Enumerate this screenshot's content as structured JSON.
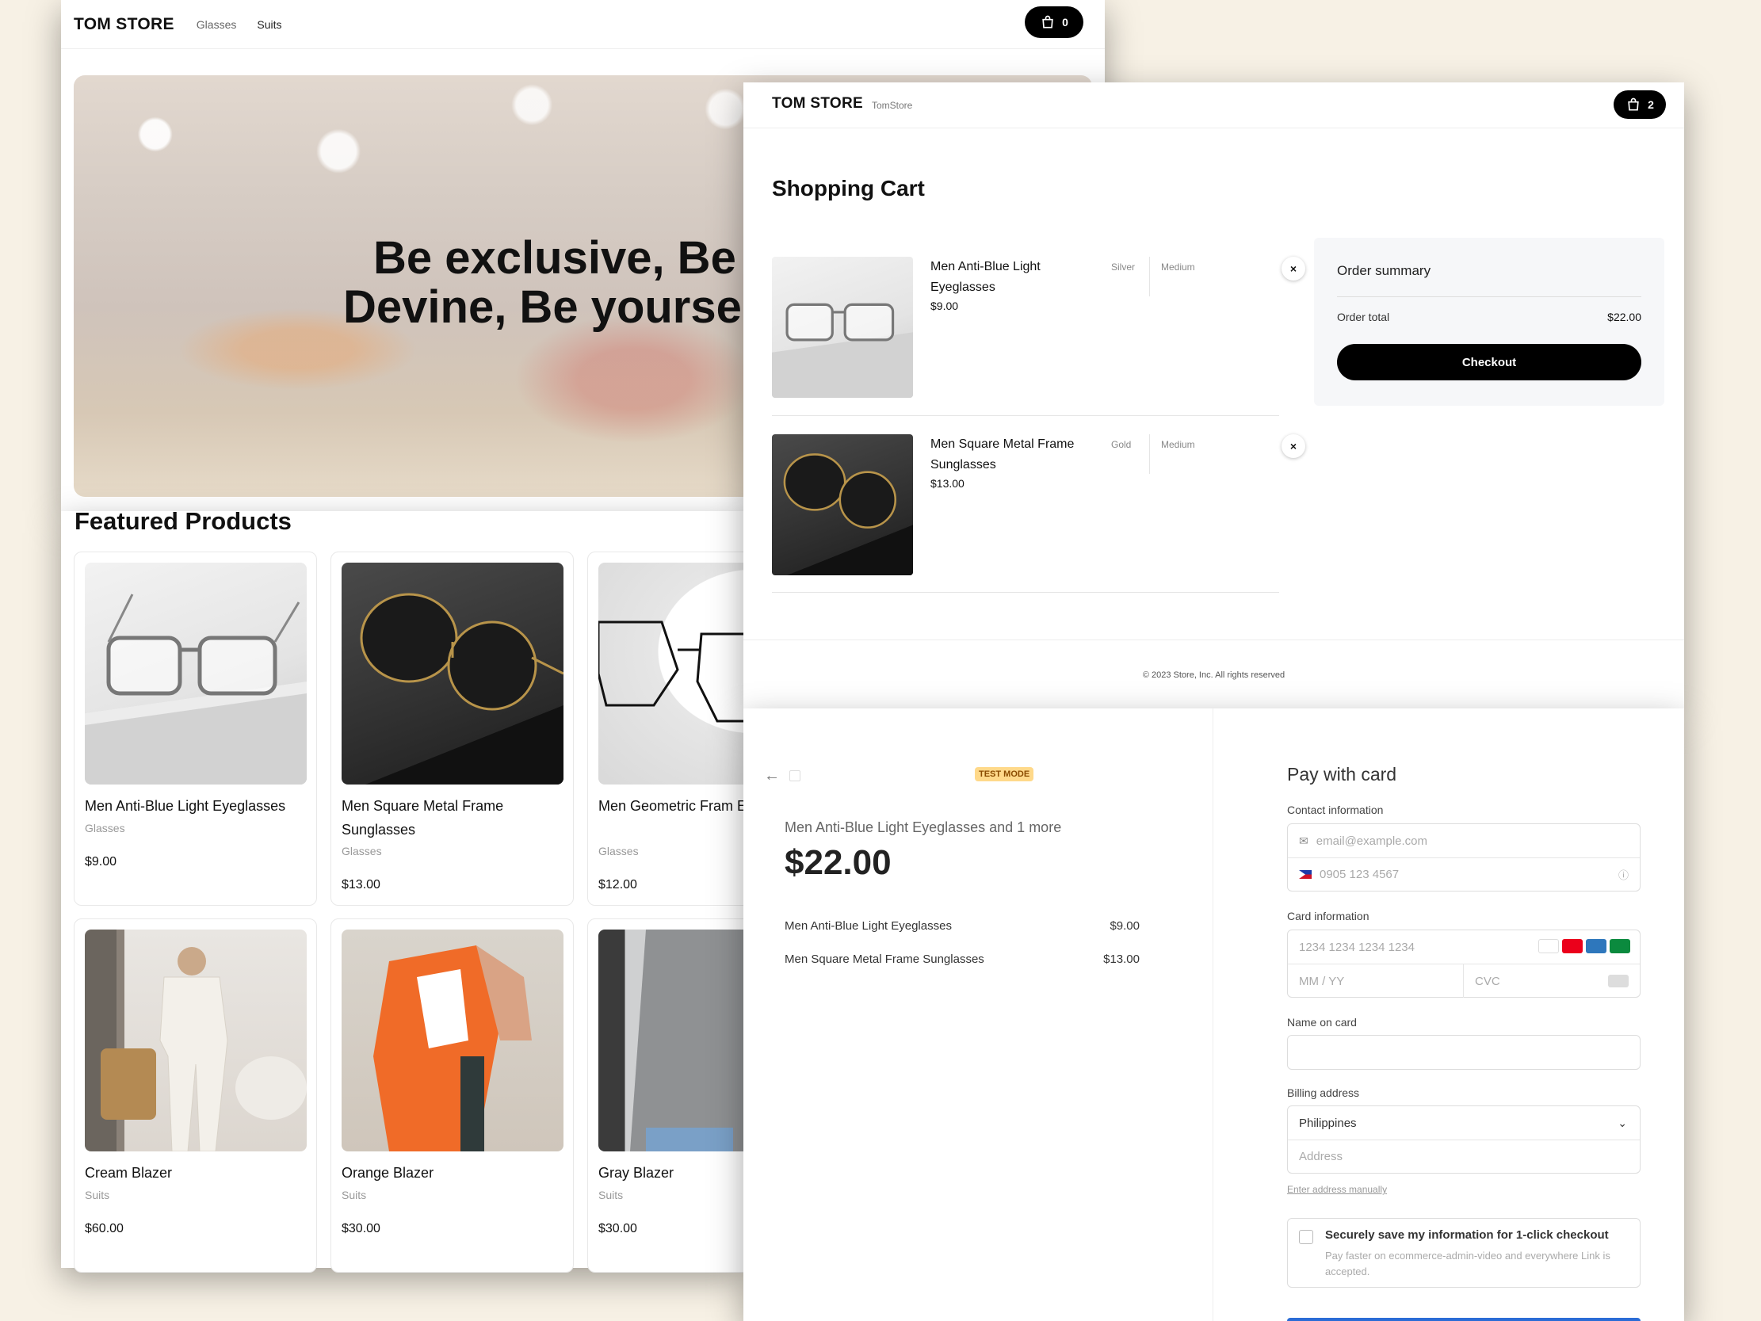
{
  "store": {
    "brand": "TOM STORE",
    "nav": [
      "Glasses",
      "Suits"
    ],
    "cart_count": "0",
    "hero_line1": "Be exclusive, Be",
    "hero_line2": "Devine, Be yourse",
    "featured_title": "Featured Products",
    "products": [
      {
        "name": "Men Anti-Blue Light Eyeglasses",
        "category": "Glasses",
        "price": "$9.00"
      },
      {
        "name": "Men Square Metal Frame Sunglasses",
        "category": "Glasses",
        "price": "$13.00"
      },
      {
        "name": "Men Geometric Fram Eyeglasses",
        "category": "Glasses",
        "price": "$12.00"
      },
      {
        "name": "Cream Blazer",
        "category": "Suits",
        "price": "$60.00"
      },
      {
        "name": "Orange Blazer",
        "category": "Suits",
        "price": "$30.00"
      },
      {
        "name": "Gray Blazer",
        "category": "Suits",
        "price": "$30.00"
      }
    ]
  },
  "cart": {
    "brand": "TOM STORE",
    "subtitle": "TomStore",
    "cart_count": "2",
    "title": "Shopping Cart",
    "items": [
      {
        "name": "Men Anti-Blue Light Eyeglasses",
        "price": "$9.00",
        "color": "Silver",
        "size": "Medium"
      },
      {
        "name": "Men Square Metal Frame Sunglasses",
        "price": "$13.00",
        "color": "Gold",
        "size": "Medium"
      }
    ],
    "remove_glyph": "×",
    "summary": {
      "title": "Order summary",
      "total_label": "Order total",
      "total_value": "$22.00",
      "checkout_label": "Checkout"
    },
    "copyright": "© 2023 Store, Inc. All rights reserved"
  },
  "payment": {
    "test_mode": "TEST MODE",
    "summary_line": "Men Anti-Blue Light Eyeglasses and 1 more",
    "amount": "$22.00",
    "line_items": [
      {
        "name": "Men Anti-Blue Light Eyeglasses",
        "amount": "$9.00"
      },
      {
        "name": "Men Square Metal Frame Sunglasses",
        "amount": "$13.00"
      }
    ],
    "title": "Pay with card",
    "contact_label": "Contact information",
    "email_placeholder": "email@example.com",
    "phone_placeholder": "0905 123 4567",
    "card_label": "Card information",
    "card_placeholder": "1234 1234 1234 1234",
    "expiry_placeholder": "MM / YY",
    "cvc_placeholder": "CVC",
    "name_label": "Name on card",
    "billing_label": "Billing address",
    "country": "Philippines",
    "address_placeholder": "Address",
    "manual_link": "Enter address manually",
    "save_title": "Securely save my information for 1-click checkout",
    "save_desc": "Pay faster on ecommerce-admin-video and everywhere Link is accepted."
  }
}
